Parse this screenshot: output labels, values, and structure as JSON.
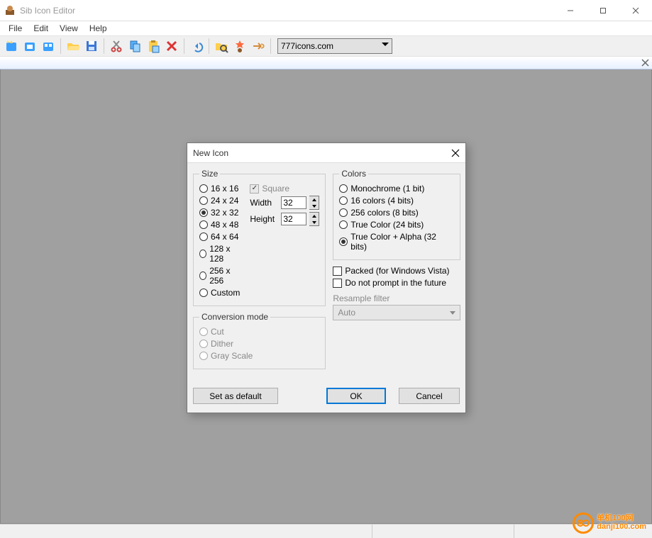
{
  "window": {
    "title": "Sib Icon Editor"
  },
  "menu": {
    "items": [
      "File",
      "Edit",
      "View",
      "Help"
    ]
  },
  "toolbar": {
    "combo_value": "777icons.com",
    "icons": [
      "new-icon-icon",
      "new-image-icon",
      "new-library-icon",
      "open-icon",
      "save-icon",
      "cut-icon",
      "copy-icon",
      "paste-icon",
      "delete-icon",
      "undo-icon",
      "search-icon",
      "wizard-icon",
      "pointer-hand-icon"
    ]
  },
  "dialog": {
    "title": "New Icon",
    "size": {
      "legend": "Size",
      "options": [
        "16 x 16",
        "24 x 24",
        "32 x 32",
        "48 x 48",
        "64 x 64",
        "128 x 128",
        "256 x 256",
        "Custom"
      ],
      "selected": "32 x 32",
      "square_label": "Square",
      "square_checked": true,
      "width_label": "Width",
      "height_label": "Height",
      "width_value": "32",
      "height_value": "32"
    },
    "colors": {
      "legend": "Colors",
      "options": [
        "Monochrome (1 bit)",
        "16 colors (4 bits)",
        "256 colors (8 bits)",
        "True Color (24 bits)",
        "True Color + Alpha (32 bits)"
      ],
      "selected": "True Color + Alpha (32 bits)"
    },
    "packed_label": "Packed (for Windows Vista)",
    "no_prompt_label": "Do not prompt in the future",
    "resample_label": "Resample filter",
    "resample_value": "Auto",
    "conversion": {
      "legend": "Conversion mode",
      "options": [
        "Cut",
        "Dither",
        "Gray Scale"
      ]
    },
    "buttons": {
      "set_default": "Set as default",
      "ok": "OK",
      "cancel": "Cancel"
    }
  },
  "watermark": {
    "text": "danji100.com",
    "label": "单机100网"
  }
}
